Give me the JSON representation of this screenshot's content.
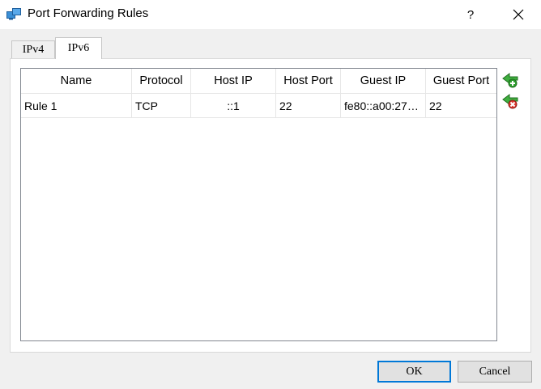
{
  "window": {
    "title": "Port Forwarding Rules",
    "help_label": "?",
    "icons": {
      "app": "network-monitors-icon",
      "close": "close-icon"
    }
  },
  "tabs": [
    {
      "label": "IPv4",
      "active": false
    },
    {
      "label": "IPv6",
      "active": true
    }
  ],
  "table": {
    "columns": [
      "Name",
      "Protocol",
      "Host IP",
      "Host Port",
      "Guest IP",
      "Guest Port"
    ],
    "rows": [
      [
        "Rule 1",
        "TCP",
        "::1",
        "22",
        "fe80::a00:27…",
        "22"
      ]
    ]
  },
  "side_icons": {
    "add": "add-rule-icon",
    "remove": "remove-rule-icon"
  },
  "buttons": {
    "ok": "OK",
    "cancel": "Cancel"
  },
  "colors": {
    "ok_border": "#0078d7",
    "add_green": "#2e9e2e",
    "remove_red": "#d9342b"
  }
}
